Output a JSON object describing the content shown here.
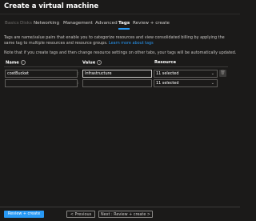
{
  "window": {
    "title": "Create a virtual machine"
  },
  "tabs": [
    {
      "label": "Basics",
      "state": "disabled"
    },
    {
      "label": "Disks",
      "state": "disabled"
    },
    {
      "label": "Networking",
      "state": "normal"
    },
    {
      "label": "Management",
      "state": "normal"
    },
    {
      "label": "Advanced",
      "state": "normal"
    },
    {
      "label": "Tags",
      "state": "active"
    },
    {
      "label": "Review + create",
      "state": "normal"
    }
  ],
  "description": {
    "text": "Tags are name/value pairs that enable you to categorize resources and view consolidated billing by applying the same tag to multiple resources and resource groups.",
    "link": "Learn more about tags"
  },
  "note": "Note that if you create tags and then change resource settings on other tabs, your tags will be automatically updated.",
  "columns": {
    "name": "Name",
    "value": "Value",
    "resource": "Resource"
  },
  "rows": [
    {
      "name": "costBucket",
      "value": "Infrastructure",
      "resource": "11 selected"
    },
    {
      "name": "",
      "value": "",
      "resource": "11 selected"
    }
  ],
  "footer": {
    "review_create": "Review + create",
    "previous": "< Previous",
    "next": "Next : Review + create >"
  },
  "colors": {
    "accent": "#2899f5",
    "background": "#1b1a19"
  }
}
